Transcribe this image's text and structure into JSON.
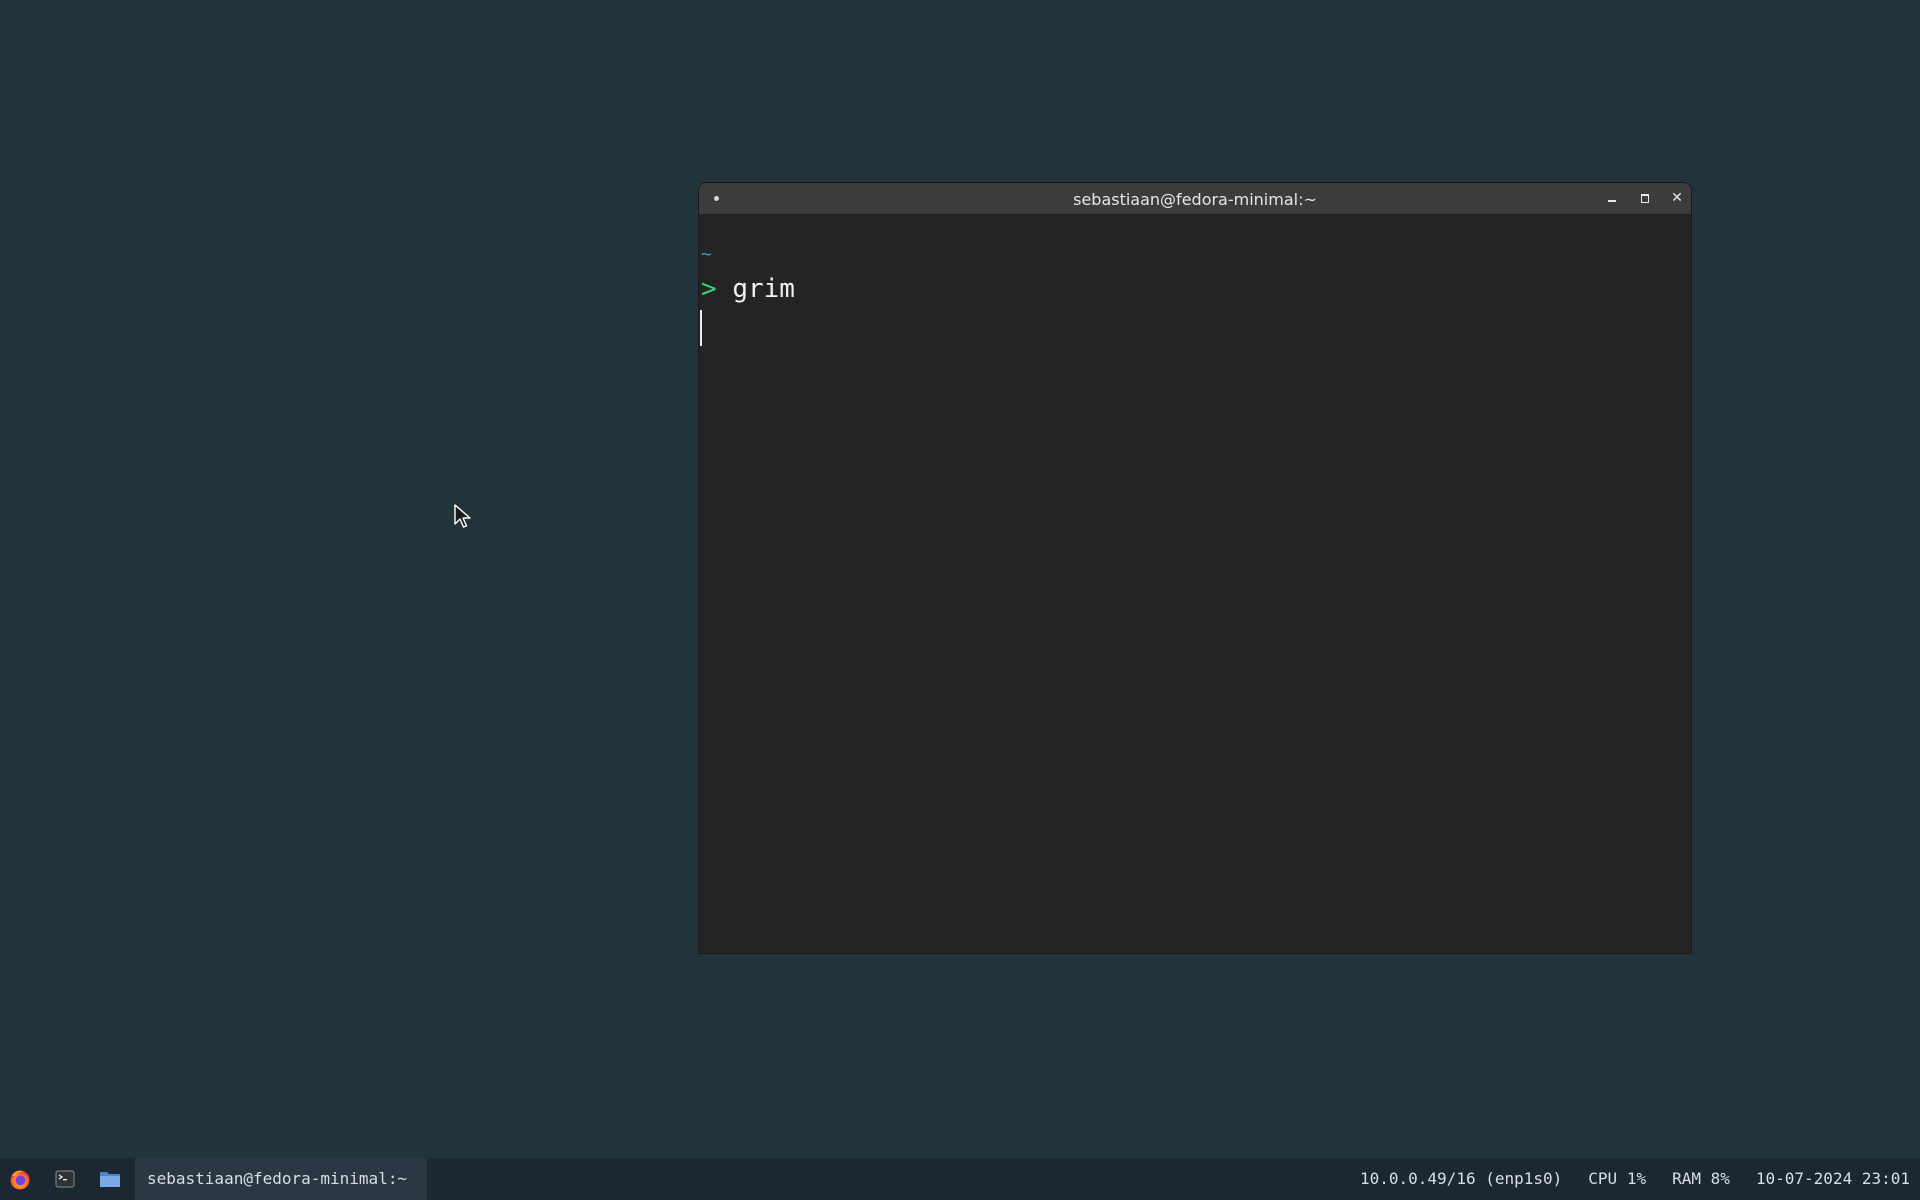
{
  "window": {
    "title": "sebastiaan@fedora-minimal:~",
    "buttons": {
      "minimize": "minimize-icon",
      "maximize": "maximize-icon",
      "close_glyph": "✕"
    }
  },
  "terminal": {
    "cwd": "~",
    "prompt_symbol": ">",
    "command": "grim"
  },
  "taskbar": {
    "launchers": [
      "firefox-icon",
      "terminal-icon",
      "files-icon"
    ],
    "active_task_label": "sebastiaan@fedora-minimal:~",
    "network": "10.0.0.49/16 (enp1s0)",
    "cpu": "CPU 1%",
    "ram": "RAM 8%",
    "datetime": "10-07-2024 23:01"
  },
  "colors": {
    "desktop": "#22333b",
    "terminal_bg": "#242424",
    "titlebar": "#3c3c3c",
    "prompt_green": "#33d17a",
    "cwd_cyan": "#2aa1b3",
    "taskbar": "#1b2832"
  }
}
